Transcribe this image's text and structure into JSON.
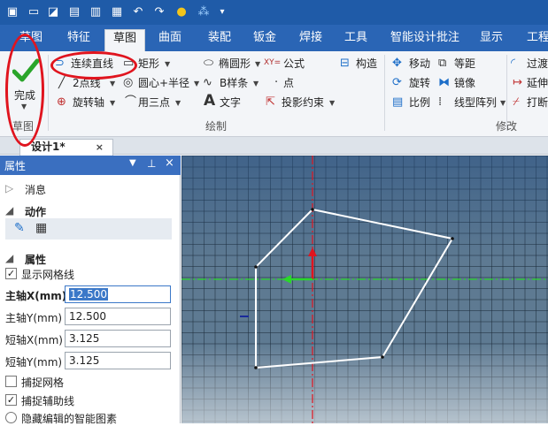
{
  "colors": {
    "titlebar": "#1f5ba8",
    "tabsbar": "#2a65b5",
    "ribbon": "#f3f5f8",
    "accent_red": "#e0141e",
    "check_green": "#2aa52a",
    "canvas": "#5e7a92"
  },
  "quick_access": {
    "icons": [
      "cube-icon",
      "new-file-icon",
      "open-file-icon",
      "image-icon",
      "folder-icon",
      "save-icon",
      "undo-icon",
      "redo-icon",
      "rebuild-icon",
      "grid-toggle-icon",
      "customize-icon"
    ]
  },
  "tabs": [
    {
      "label": "草图"
    },
    {
      "label": "特征"
    },
    {
      "label": "草图"
    },
    {
      "label": "曲面"
    },
    {
      "label": "装配"
    },
    {
      "label": "钣金"
    },
    {
      "label": "焊接"
    },
    {
      "label": "工具"
    },
    {
      "label": "智能设计批注"
    },
    {
      "label": "显示"
    },
    {
      "label": "工程"
    }
  ],
  "ribbon": {
    "finish": {
      "label": "完成",
      "group": "草图"
    },
    "draw": {
      "group": "绘制",
      "polyline": "连续直线",
      "two_point_line": "2点线",
      "rotate_axis": "旋转轴",
      "rectangle": "矩形",
      "center_radius": "圆心+半径",
      "three_point": "用三点",
      "ellipse": "椭圆形",
      "b_spline": "B样条",
      "text": "文字",
      "formula": "公式",
      "point": "点",
      "projection_constraint": "投影约束",
      "construct": "构造"
    },
    "modify": {
      "group": "修改",
      "move": "移动",
      "offset": "等距",
      "transition": "过渡",
      "rotate": "旋转",
      "mirror": "镜像",
      "extend": "延伸",
      "scale": "比例",
      "linear_array": "线型阵列",
      "break": "打断"
    }
  },
  "doc_tab": {
    "title": "设计1*"
  },
  "panel": {
    "title": "属性",
    "messages": "消息",
    "actions": "动作",
    "properties": "属性",
    "show_grid": "显示网格线",
    "major_x_label": "主轴X(mm)",
    "major_x_value": "12.500",
    "major_y_label": "主轴Y(mm)",
    "major_y_value": "12.500",
    "minor_x_label": "短轴X(mm)",
    "minor_x_value": "3.125",
    "minor_y_label": "短轴Y(mm)",
    "minor_y_value": "3.125",
    "snap_grid": "捕捉网格",
    "snap_guides": "捕捉辅助线",
    "hide_smart": "隐藏编辑的智能图素"
  }
}
